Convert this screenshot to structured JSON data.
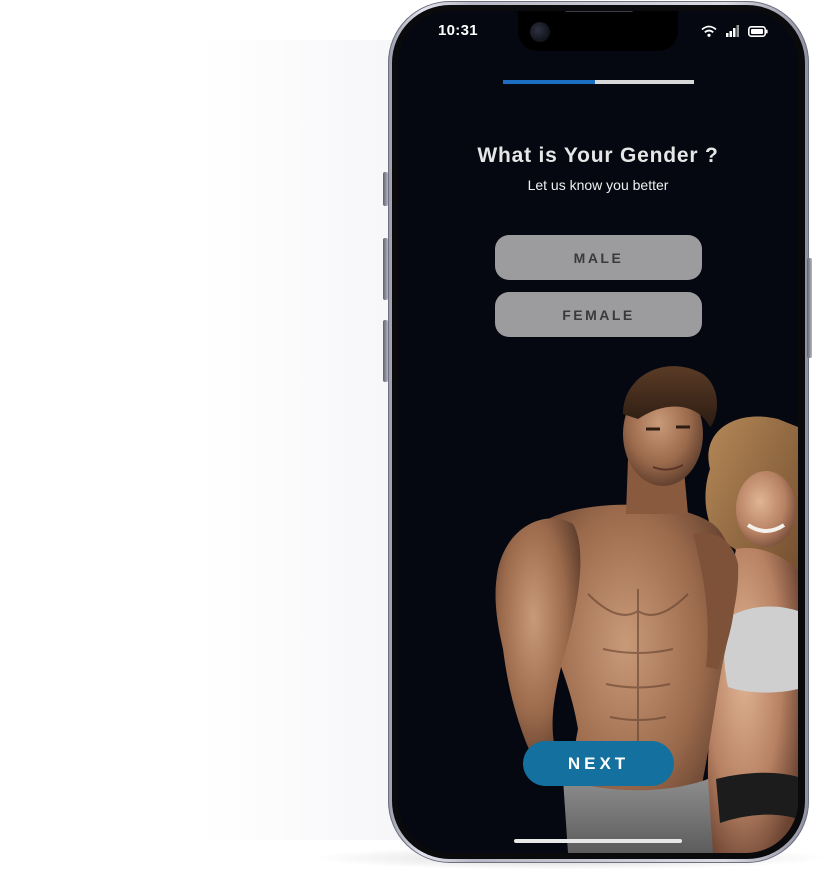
{
  "status_bar": {
    "time": "10:31",
    "icons": [
      "wifi-icon",
      "signal-icon",
      "battery-icon"
    ]
  },
  "onboarding": {
    "progress": 0.48,
    "title": "What is Your Gender ?",
    "subtitle": "Let us know you better",
    "options": [
      {
        "label": "MALE"
      },
      {
        "label": "FEMALE"
      }
    ],
    "next_label": "NEXT"
  },
  "colors": {
    "screen_background": "#050810",
    "progress_fill": "#1b6ec2",
    "progress_track": "#d8d8d8",
    "option_background": "#9c9c9e",
    "option_text": "#3a3a3c",
    "next_background": "#14709e"
  }
}
